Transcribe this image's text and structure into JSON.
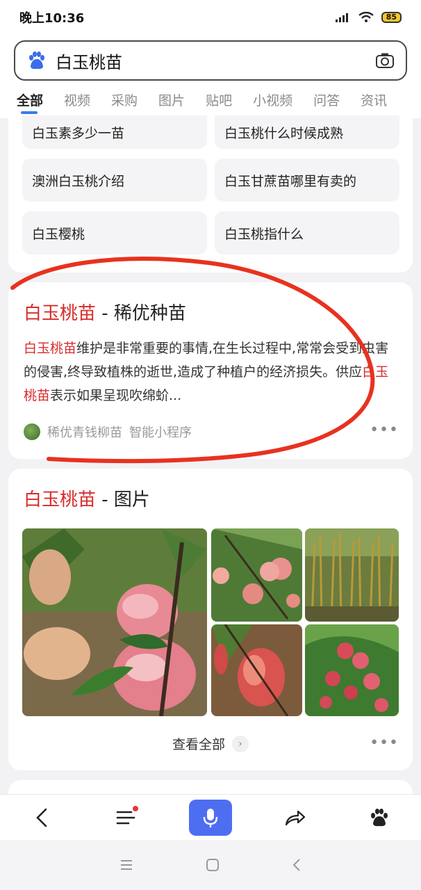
{
  "status": {
    "time": "晚上10:36",
    "battery": "85"
  },
  "search": {
    "query": "白玉桃苗"
  },
  "tabs": [
    "全部",
    "视频",
    "采购",
    "图片",
    "贴吧",
    "小视频",
    "问答",
    "资讯"
  ],
  "related": [
    "白玉素多少一苗",
    "白玉桃什么时候成熟",
    "澳洲白玉桃介绍",
    "白玉甘蔗苗哪里有卖的",
    "白玉樱桃",
    "白玉桃指什么"
  ],
  "result1": {
    "title_highlight": "白玉桃苗",
    "title_rest": " - 稀优种苗",
    "snippet_h1": "白玉桃苗",
    "snippet_p1": "维护是非常重要的事情,在生长过程中,常常会受到虫害的侵害,终导致植株的逝世,造成了种植户的经济损失。供应",
    "snippet_h2": "白玉桃苗",
    "snippet_p2": "表示如果呈现吹绵蚧...",
    "source_name": "稀优青钱柳苗",
    "source_tag": "智能小程序"
  },
  "result2": {
    "title_highlight": "白玉桃苗",
    "title_rest": " - 图片",
    "view_all": "查看全部"
  },
  "colors": {
    "accent": "#4e6ef2",
    "highlight": "#d92b2b",
    "annotation": "#e8321f"
  }
}
